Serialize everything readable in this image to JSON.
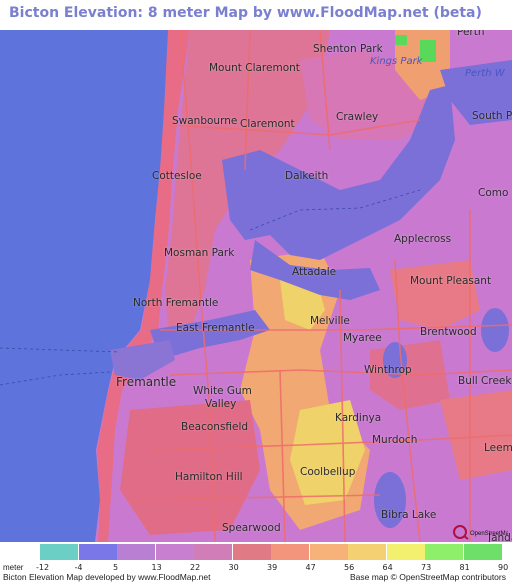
{
  "title": "Bicton Elevation: 8 meter Map by www.FloodMap.net (beta)",
  "places": [
    {
      "id": "perth",
      "label": "Perth"
    },
    {
      "id": "shenton-park",
      "label": "Shenton Park"
    },
    {
      "id": "kings-park",
      "label": "Kings Park"
    },
    {
      "id": "mount-claremont",
      "label": "Mount Claremont"
    },
    {
      "id": "perth-water",
      "label": "Perth W"
    },
    {
      "id": "swanbourne",
      "label": "Swanbourne"
    },
    {
      "id": "claremont",
      "label": "Claremont"
    },
    {
      "id": "crawley",
      "label": "Crawley"
    },
    {
      "id": "south-perth",
      "label": "South Pert"
    },
    {
      "id": "cottesloe",
      "label": "Cottesloe"
    },
    {
      "id": "dalkeith",
      "label": "Dalkeith"
    },
    {
      "id": "como",
      "label": "Como"
    },
    {
      "id": "applecross",
      "label": "Applecross"
    },
    {
      "id": "mosman-park",
      "label": "Mosman Park"
    },
    {
      "id": "attadale",
      "label": "Attadale"
    },
    {
      "id": "mount-pleasant",
      "label": "Mount Pleasant"
    },
    {
      "id": "north-fremantle",
      "label": "North Fremantle"
    },
    {
      "id": "melville",
      "label": "Melville"
    },
    {
      "id": "east-fremantle",
      "label": "East Fremantle"
    },
    {
      "id": "myaree",
      "label": "Myaree"
    },
    {
      "id": "brentwood",
      "label": "Brentwood"
    },
    {
      "id": "winthrop",
      "label": "Winthrop"
    },
    {
      "id": "fremantle",
      "label": "Fremantle"
    },
    {
      "id": "bull-creek",
      "label": "Bull Creek"
    },
    {
      "id": "white-gum-valley",
      "label": "White Gum"
    },
    {
      "id": "white-gum-valley-2",
      "label": "Valley"
    },
    {
      "id": "kardinya",
      "label": "Kardinya"
    },
    {
      "id": "beaconsfield",
      "label": "Beaconsfield"
    },
    {
      "id": "murdoch",
      "label": "Murdoch"
    },
    {
      "id": "leeming",
      "label": "Leem"
    },
    {
      "id": "coolbellup",
      "label": "Coolbellup"
    },
    {
      "id": "hamilton-hill",
      "label": "Hamilton Hill"
    },
    {
      "id": "bibra-lake",
      "label": "Bibra Lake"
    },
    {
      "id": "spearwood",
      "label": "Spearwood"
    },
    {
      "id": "jandakot",
      "label": "Janda"
    }
  ],
  "logo_text": "OpenStreetMap",
  "legend": {
    "unit": "meter",
    "ticks": [
      "-12",
      "-4",
      "5",
      "13",
      "22",
      "30",
      "39",
      "47",
      "56",
      "64",
      "73",
      "81",
      "90"
    ],
    "colors": [
      "#6ccfc6",
      "#7a78e8",
      "#b97fd2",
      "#c97fd0",
      "#d07db8",
      "#e07a84",
      "#f2957c",
      "#f7b27a",
      "#f5d072",
      "#f2f06e",
      "#8ef06a",
      "#6ee06a"
    ]
  },
  "footer": {
    "left": "Bicton Elevation Map developed by www.FloodMap.net",
    "right": "Base map © OpenStreetMap contributors"
  },
  "colors": {
    "sea": "#5e73dc",
    "river": "#7b6fd8",
    "urban_low": "#c77bcf",
    "urban_mid": "#e06e8a",
    "urban_high": "#f09a70",
    "hill": "#f0d26a",
    "park": "#59d85a"
  }
}
